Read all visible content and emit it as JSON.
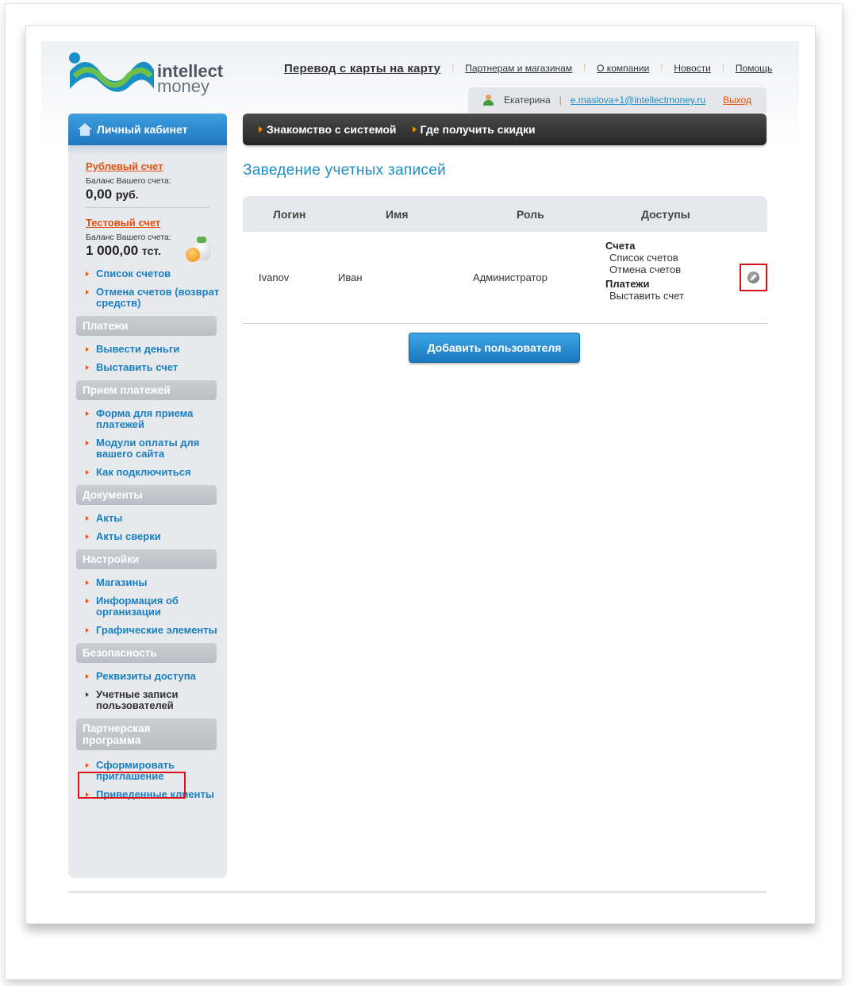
{
  "logo": {
    "line1": "intellect",
    "line2": "money"
  },
  "topnav": {
    "main": "Перевод с карты на карту",
    "links": [
      "Партнерам и магазинам",
      "О компании",
      "Новости",
      "Помощь"
    ],
    "separator": "⁞"
  },
  "userbar": {
    "name": "Екатерина",
    "email": "e.maslova+1@intellectmoney.ru",
    "logout": "Выход",
    "separator": "|"
  },
  "sidebar": {
    "title": "Личный кабинет",
    "accounts": [
      {
        "name": "Рублевый счет",
        "label": "Баланс Вашего счета:",
        "value": "0,00",
        "unit": "руб."
      },
      {
        "name": "Тестовый счет",
        "label": "Баланс Вашего счета:",
        "value": "1 000,00",
        "unit": "тст."
      }
    ],
    "account_links": [
      "Список счетов",
      "Отмена счетов (возврат средств)"
    ],
    "sections": [
      {
        "title": "Платежи",
        "items": [
          "Вывести деньги",
          "Выставить счет"
        ]
      },
      {
        "title": "Прием платежей",
        "items": [
          "Форма для приема платежей",
          "Модули оплаты для вашего сайта",
          "Как подключиться"
        ]
      },
      {
        "title": "Документы",
        "items": [
          "Акты",
          "Акты сверки"
        ]
      },
      {
        "title": "Настройки",
        "items": [
          "Магазины",
          "Информация об организации",
          "Графические элементы"
        ]
      },
      {
        "title": "Безопасность",
        "items": [
          "Реквизиты доступа",
          "Учетные записи пользователей"
        ],
        "active_index": 1
      },
      {
        "title": "Партнерская программа",
        "items": [
          "Сформировать приглашение",
          "Приведенные клиенты"
        ]
      }
    ]
  },
  "mainbar": {
    "items": [
      "Знакомство с системой",
      "Где получить скидки"
    ]
  },
  "main": {
    "title": "Заведение учетных записей",
    "table": {
      "headers": [
        "Логин",
        "Имя",
        "Роль",
        "Доступы"
      ],
      "rows": [
        {
          "login": "Ivanov",
          "name": "Иван",
          "role": "Администратор",
          "access": [
            {
              "group": "Счета",
              "perms": [
                "Список счетов",
                "Отмена счетов"
              ]
            },
            {
              "group": "Платежи",
              "perms": [
                "Выставить счет"
              ]
            }
          ]
        }
      ]
    },
    "add_button": "Добавить пользователя"
  },
  "colors": {
    "accent_blue": "#1a8fc5",
    "accent_orange": "#e0520f",
    "highlight_red": "#d7141c"
  }
}
